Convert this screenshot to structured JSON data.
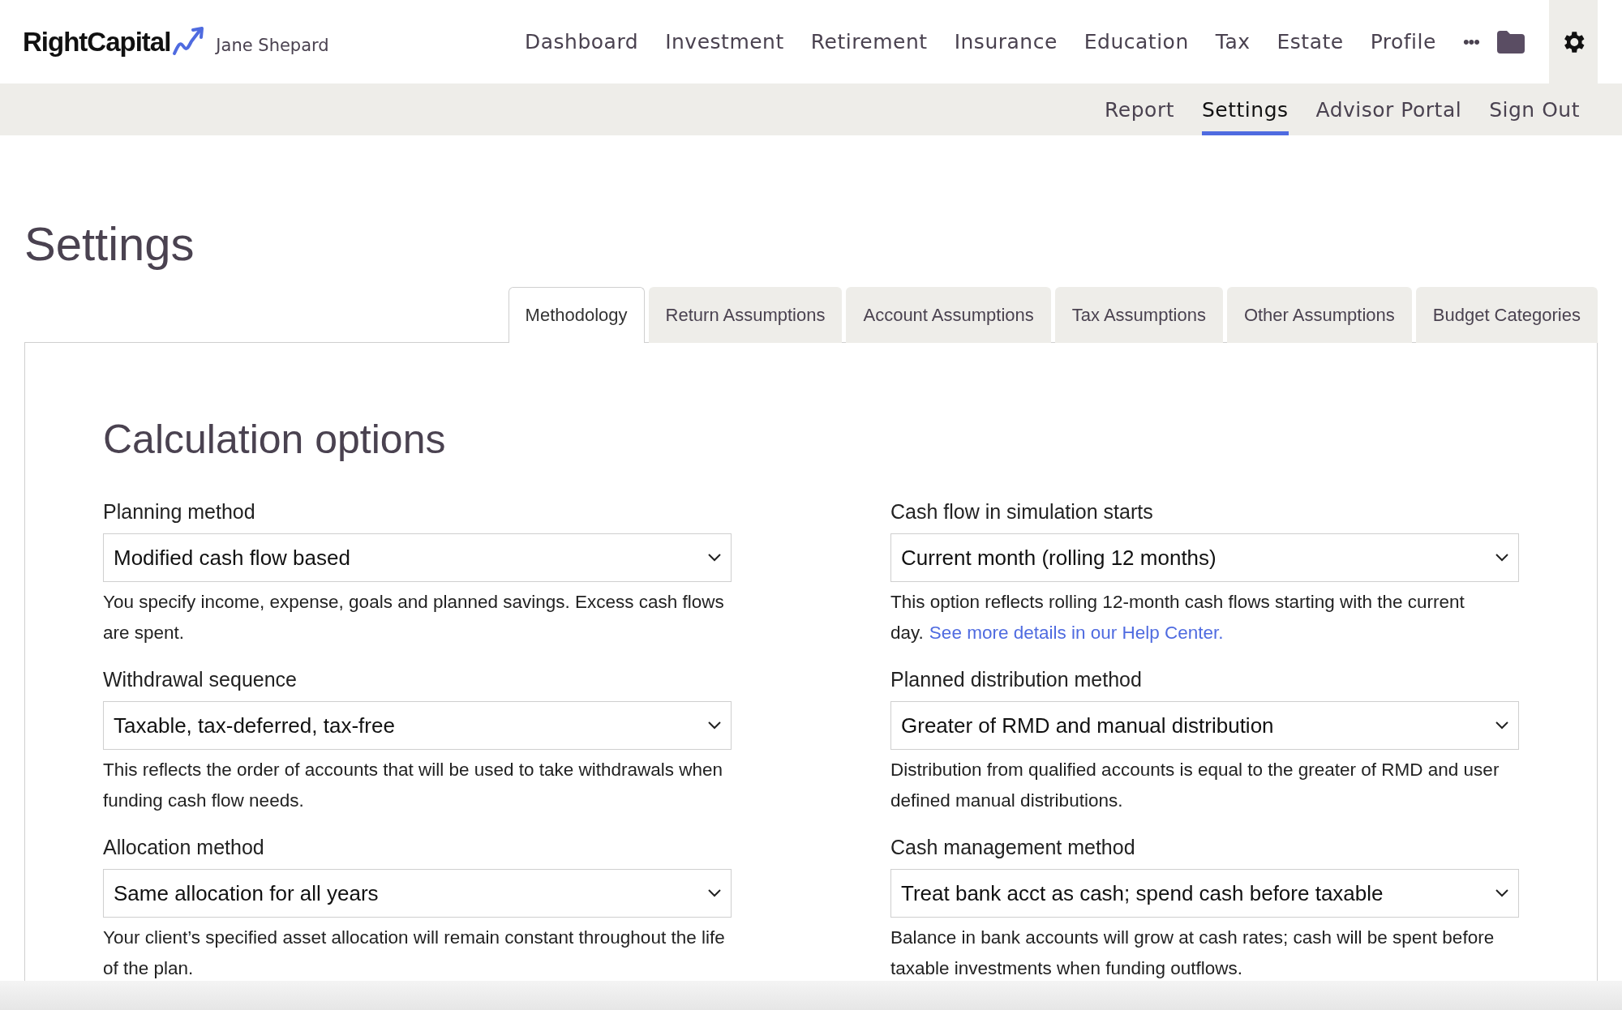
{
  "brand": {
    "logo": "RightCapital",
    "client": "Jane Shepard"
  },
  "main_nav": [
    {
      "label": "Dashboard"
    },
    {
      "label": "Investment"
    },
    {
      "label": "Retirement"
    },
    {
      "label": "Insurance"
    },
    {
      "label": "Education"
    },
    {
      "label": "Tax"
    },
    {
      "label": "Estate"
    },
    {
      "label": "Profile"
    }
  ],
  "more_button": "•••",
  "sub_nav": [
    {
      "label": "Report",
      "selected": false
    },
    {
      "label": "Settings",
      "selected": true
    },
    {
      "label": "Advisor Portal",
      "selected": false
    },
    {
      "label": "Sign Out",
      "selected": false
    }
  ],
  "page_title": "Settings",
  "tabs": [
    {
      "label": "Methodology",
      "selected": true
    },
    {
      "label": "Return Assumptions",
      "selected": false
    },
    {
      "label": "Account Assumptions",
      "selected": false
    },
    {
      "label": "Tax Assumptions",
      "selected": false
    },
    {
      "label": "Other Assumptions",
      "selected": false
    },
    {
      "label": "Budget Categories",
      "selected": false
    }
  ],
  "section_title": "Calculation options",
  "fields": [
    {
      "label": "Planning method",
      "value": "Modified cash flow based",
      "help": "You specify income, expense, goals and planned savings. Excess cash flows are spent."
    },
    {
      "label": "Cash flow in simulation starts",
      "value": "Current month (rolling 12 months)",
      "help": "This option reflects rolling 12-month cash flows starting with the current day.",
      "link": "See more details in our Help Center."
    },
    {
      "label": "Withdrawal sequence",
      "value": "Taxable, tax-deferred, tax-free",
      "help": "This reflects the order of accounts that will be used to take withdrawals when funding cash flow needs."
    },
    {
      "label": "Planned distribution method",
      "value": "Greater of RMD and manual distribution",
      "help": "Distribution from qualified accounts is equal to the greater of RMD and user defined manual distributions."
    },
    {
      "label": "Allocation method",
      "value": "Same allocation for all years",
      "help": "Your client’s specified asset allocation will remain constant throughout the life of the plan."
    },
    {
      "label": "Cash management method",
      "value": "Treat bank acct as cash; spend cash before taxable",
      "help": "Balance in bank accounts will grow at cash rates; cash will be spent before taxable investments when funding outflows."
    }
  ]
}
